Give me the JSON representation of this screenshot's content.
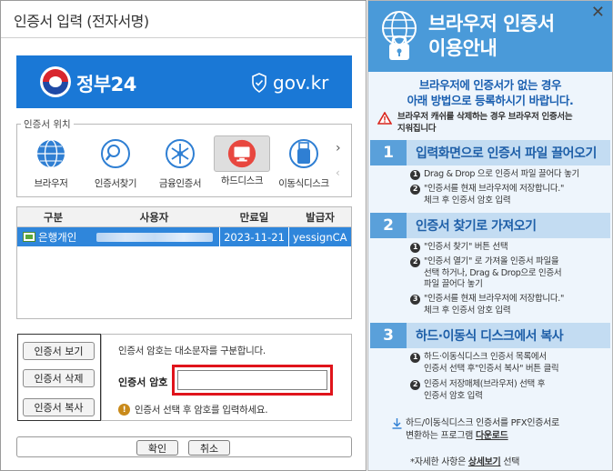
{
  "dialog": {
    "title": "인증서 입력 (전자서명)",
    "banner": {
      "org_name": "정부24",
      "domain": "gov.kr"
    },
    "cert_location": {
      "label": "인증서 위치",
      "items": [
        {
          "label": "브라우저",
          "icon": "globe-icon"
        },
        {
          "label": "인증서찾기",
          "icon": "search-icon"
        },
        {
          "label": "금융인증서",
          "icon": "financial-cert-icon"
        },
        {
          "label": "하드디스크",
          "icon": "hard-disk-icon",
          "selected": true
        },
        {
          "label": "이동식디스크",
          "icon": "usb-icon"
        }
      ],
      "next_arrow": "›",
      "prev_arrow": "‹"
    },
    "table": {
      "columns": [
        "구분",
        "사용자",
        "만료일",
        "발급자"
      ],
      "rows": [
        {
          "type": "은행개인",
          "user": "",
          "expiry": "2023-11-21",
          "issuer": "yessignCA ..."
        }
      ]
    },
    "buttons": {
      "view": "인증서 보기",
      "delete": "인증서 삭제",
      "copy": "인증서 복사"
    },
    "password": {
      "note": "인증서 암호는 대소문자를 구분합니다.",
      "label": "인증서 암호",
      "value": "",
      "hint": "인증서 선택 후 암호를 입력하세요."
    },
    "footer": {
      "ok": "확인",
      "cancel": "취소"
    }
  },
  "guide": {
    "title_line1": "브라우저 인증서",
    "title_line2": "이용안내",
    "close": "✕",
    "intro_line1": "브라우저에 인증서가 없는 경우",
    "intro_line2": "아래 방법으로 등록하시기 바랍니다.",
    "warning_line1": "브라우저 캐쉬를 삭제하는 경우 브라우저 인증서는",
    "warning_line2": "지워집니다",
    "sections": [
      {
        "num": "1",
        "title": "입력화면으로 인증서 파일 끌어오기",
        "steps": [
          {
            "n": "1",
            "lines": [
              "Drag & Drop 으로 인증서 파일 끌어다 놓기"
            ]
          },
          {
            "n": "2",
            "lines": [
              "\"인증서를 현재 브라우저에 저장합니다.\"",
              "체크 후 인증서 암호 입력"
            ]
          }
        ]
      },
      {
        "num": "2",
        "title": "인증서 찾기로 가져오기",
        "steps": [
          {
            "n": "1",
            "lines": [
              "\"인증서 찾기\" 버튼 선택"
            ]
          },
          {
            "n": "2",
            "lines": [
              "\"인증서 열기\" 로 가져올 인증서 파일을",
              "선택 하거나, Drag & Drop으로 인증서",
              "파일 끌어다 놓기"
            ]
          },
          {
            "n": "3",
            "lines": [
              "\"인증서를 현재 브라우저에 저장합니다.\"",
              "체크 후 인증서 암호 입력"
            ]
          }
        ]
      },
      {
        "num": "3",
        "title": "하드·이동식 디스크에서 복사",
        "steps": [
          {
            "n": "1",
            "lines": [
              "하드·이동식디스크 인증서 목록에서",
              "인증서 선택 후\"인증서 복사\" 버튼 클릭"
            ]
          },
          {
            "n": "2",
            "lines": [
              "인증서 저장매체(브라우저) 선택 후",
              "인증서 암호 입력"
            ]
          }
        ]
      }
    ],
    "download_line1": "하드/이동식디스크 인증서를 PFX인증서로",
    "download_prefix": "변환하는 프로그램 ",
    "download_link": "다운로드",
    "detail_prefix": "*자세한 사항은 ",
    "detail_link": "상세보기",
    "detail_suffix": " 선택"
  },
  "colors": {
    "banner_blue": "#1a78d6",
    "selected_row": "#2f86db",
    "password_highlight": "#e0141b",
    "guide_header": "#4a9ad9",
    "guide_text_blue": "#1e5fa8"
  }
}
